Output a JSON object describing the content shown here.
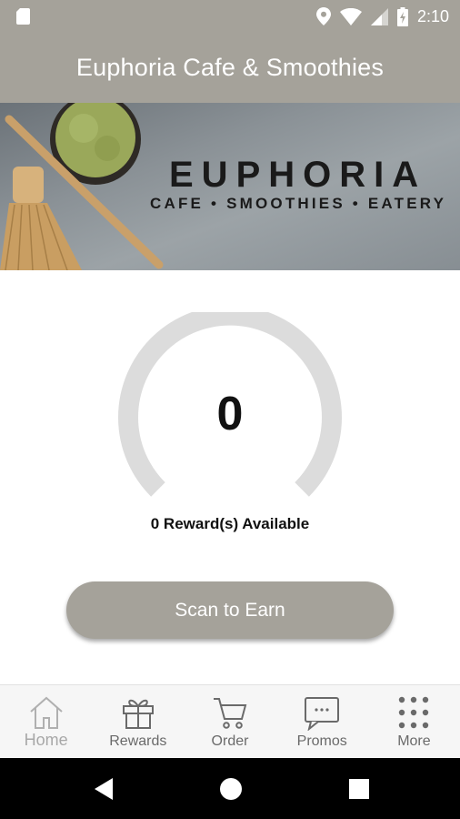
{
  "status_bar": {
    "time": "2:10",
    "icons": [
      "sd-card-icon",
      "location-icon",
      "wifi-icon",
      "signal-icon",
      "battery-charging-icon"
    ]
  },
  "app_bar": {
    "title": "Euphoria Cafe & Smoothies"
  },
  "banner": {
    "brand_name": "EUPHORIA",
    "tagline": "CAFE • SMOOTHIES • EATERY"
  },
  "rewards": {
    "points": "0",
    "available_text": "0 Reward(s) Available",
    "progress": 0
  },
  "actions": {
    "scan_label": "Scan to Earn"
  },
  "bottom_nav": {
    "items": [
      {
        "label": "Home",
        "icon": "home-icon",
        "active": true
      },
      {
        "label": "Rewards",
        "icon": "gift-icon",
        "active": false
      },
      {
        "label": "Order",
        "icon": "cart-icon",
        "active": false
      },
      {
        "label": "Promos",
        "icon": "chat-bubble-icon",
        "active": false
      },
      {
        "label": "More",
        "icon": "grid-dots-icon",
        "active": false
      }
    ]
  },
  "colors": {
    "primary": "#a5a29a",
    "gauge_track": "#dcdcdc",
    "nav_background": "#f6f6f6"
  }
}
